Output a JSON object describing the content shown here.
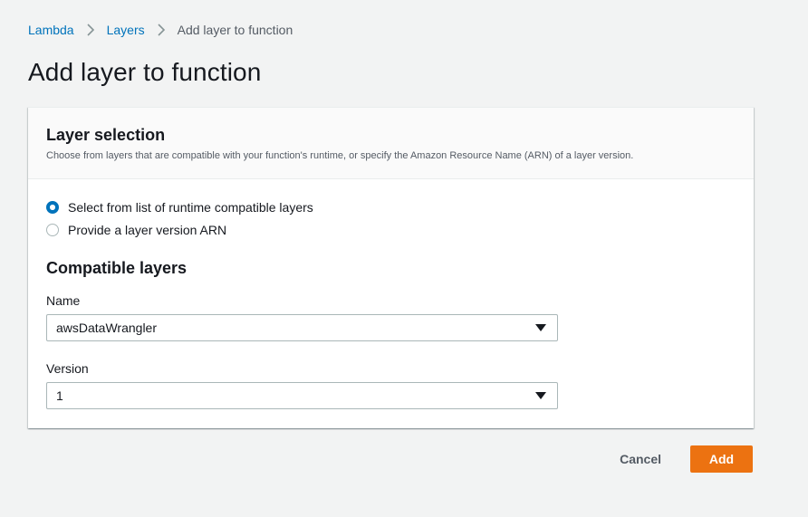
{
  "breadcrumb": {
    "items": [
      {
        "label": "Lambda"
      },
      {
        "label": "Layers"
      },
      {
        "label": "Add layer to function"
      }
    ]
  },
  "page": {
    "title": "Add layer to function"
  },
  "layer_selection": {
    "title": "Layer selection",
    "description": "Choose from layers that are compatible with your function's runtime, or specify the Amazon Resource Name (ARN) of a layer version.",
    "options": [
      {
        "label": "Select from list of runtime compatible layers",
        "checked": true
      },
      {
        "label": "Provide a layer version ARN",
        "checked": false
      }
    ]
  },
  "compatible_layers": {
    "title": "Compatible layers",
    "name_label": "Name",
    "name_value": "awsDataWrangler",
    "version_label": "Version",
    "version_value": "1"
  },
  "actions": {
    "cancel_label": "Cancel",
    "add_label": "Add"
  },
  "colors": {
    "link": "#0073bb",
    "primary": "#ec7211",
    "background": "#f2f3f3"
  }
}
